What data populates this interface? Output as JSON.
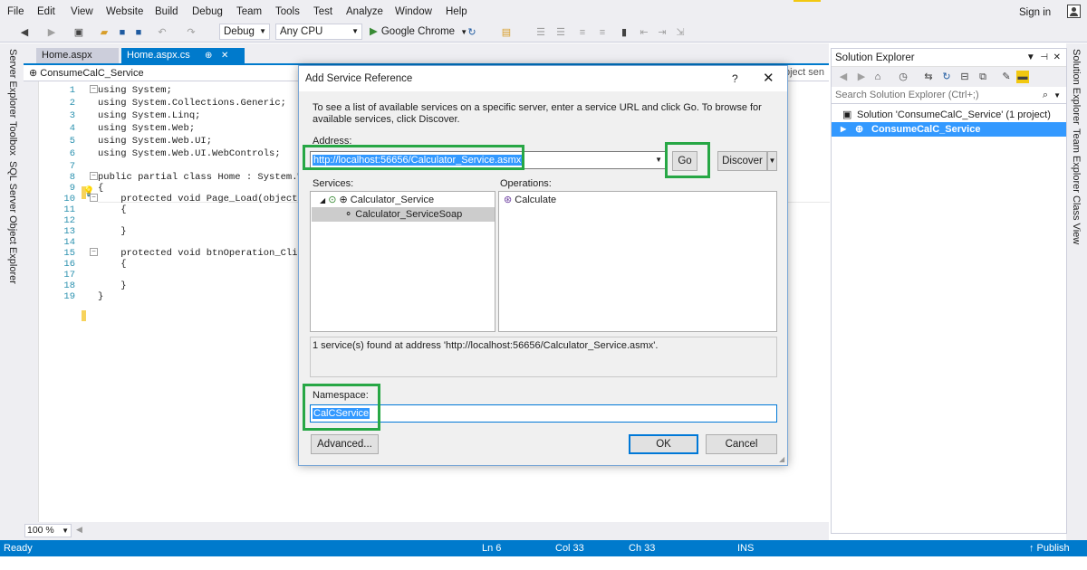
{
  "menu": {
    "items": [
      "File",
      "Edit",
      "View",
      "Website",
      "Build",
      "Debug",
      "Team",
      "Tools",
      "Test",
      "Analyze",
      "Window",
      "Help"
    ],
    "sign_in": "Sign in"
  },
  "toolbar": {
    "config": "Debug",
    "platform": "Any CPU",
    "run_target": "Google Chrome"
  },
  "left_rail": {
    "tabs": [
      "Server Explorer",
      "Toolbox",
      "SQL Server Object Explorer"
    ]
  },
  "right_rail": {
    "tabs": [
      "Solution Explorer",
      "Team Explorer",
      "Class View"
    ]
  },
  "editor": {
    "tabs": [
      {
        "label": "Home.aspx",
        "active": false
      },
      {
        "label": "Home.aspx.cs",
        "active": true,
        "pin": "⊕",
        "close": "✕"
      }
    ],
    "nav_project": "ConsumeCalC_Service",
    "nav_right": "bject sen",
    "zoom": "100 %",
    "lines": [
      {
        "n": "1",
        "text": "using System;"
      },
      {
        "n": "2",
        "text": "using System.Collections.Generic;"
      },
      {
        "n": "3",
        "text": "using System.Linq;"
      },
      {
        "n": "4",
        "text": "using System.Web;"
      },
      {
        "n": "5",
        "text": "using System.Web.UI;"
      },
      {
        "n": "6",
        "text": "using System.Web.UI.WebControls;"
      },
      {
        "n": "7",
        "text": ""
      },
      {
        "n": "8",
        "text": "public partial class Home : System.W"
      },
      {
        "n": "9",
        "text": "{"
      },
      {
        "n": "10",
        "text": "    protected void Page_Load(object"
      },
      {
        "n": "11",
        "text": "    {"
      },
      {
        "n": "12",
        "text": ""
      },
      {
        "n": "13",
        "text": "    }"
      },
      {
        "n": "14",
        "text": ""
      },
      {
        "n": "15",
        "text": "    protected void btnOperation_Clic"
      },
      {
        "n": "16",
        "text": "    {"
      },
      {
        "n": "17",
        "text": ""
      },
      {
        "n": "18",
        "text": "    }"
      },
      {
        "n": "19",
        "text": "}"
      }
    ]
  },
  "solution_explorer": {
    "title": "Solution Explorer",
    "search_placeholder": "Search Solution Explorer (Ctrl+;)",
    "solution_label": "Solution 'ConsumeCalC_Service' (1 project)",
    "project_label": "ConsumeCalC_Service"
  },
  "dialog": {
    "title": "Add Service Reference",
    "help": "?",
    "close": "✕",
    "instructions": "To see a list of available services on a specific server, enter a service URL and click Go. To browse for available services, click Discover.",
    "address_label": "Address:",
    "address_value": "http://localhost:56656/Calculator_Service.asmx",
    "go_label": "Go",
    "discover_label": "Discover",
    "services_label": "Services:",
    "operations_label": "Operations:",
    "service_name": "Calculator_Service",
    "service_soap": "Calculator_ServiceSoap",
    "operation": "Calculate",
    "status": "1 service(s) found at address 'http://localhost:56656/Calculator_Service.asmx'.",
    "namespace_label": "Namespace:",
    "namespace_value": "CalCService",
    "advanced_label": "Advanced...",
    "ok_label": "OK",
    "cancel_label": "Cancel"
  },
  "status_bar": {
    "ready": "Ready",
    "ln": "Ln 6",
    "col": "Col 33",
    "ch": "Ch 33",
    "ins": "INS",
    "publish": "↑ Publish"
  },
  "colors": {
    "accent": "#007acc",
    "selection": "#3399ff",
    "highlight_box": "#27a745"
  }
}
